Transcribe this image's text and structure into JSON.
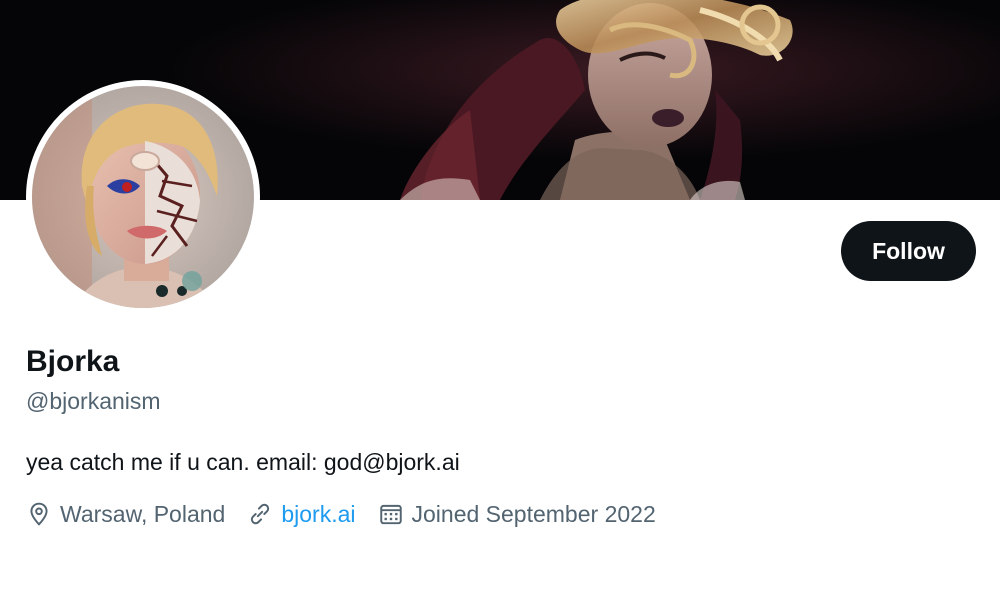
{
  "profile": {
    "display_name": "Bjorka",
    "handle": "@bjorkanism",
    "bio": "yea catch me if u can. email: god@bjork.ai",
    "location": "Warsaw, Poland",
    "website": "bjork.ai",
    "joined": "Joined September 2022"
  },
  "actions": {
    "follow_label": "Follow"
  },
  "icons": {
    "location": "location-pin-icon",
    "website": "link-icon",
    "joined": "calendar-icon"
  },
  "colors": {
    "text_primary": "#0f1419",
    "text_secondary": "#536471",
    "link": "#1d9bf0",
    "button_bg": "#0f1419",
    "button_text": "#ffffff"
  }
}
